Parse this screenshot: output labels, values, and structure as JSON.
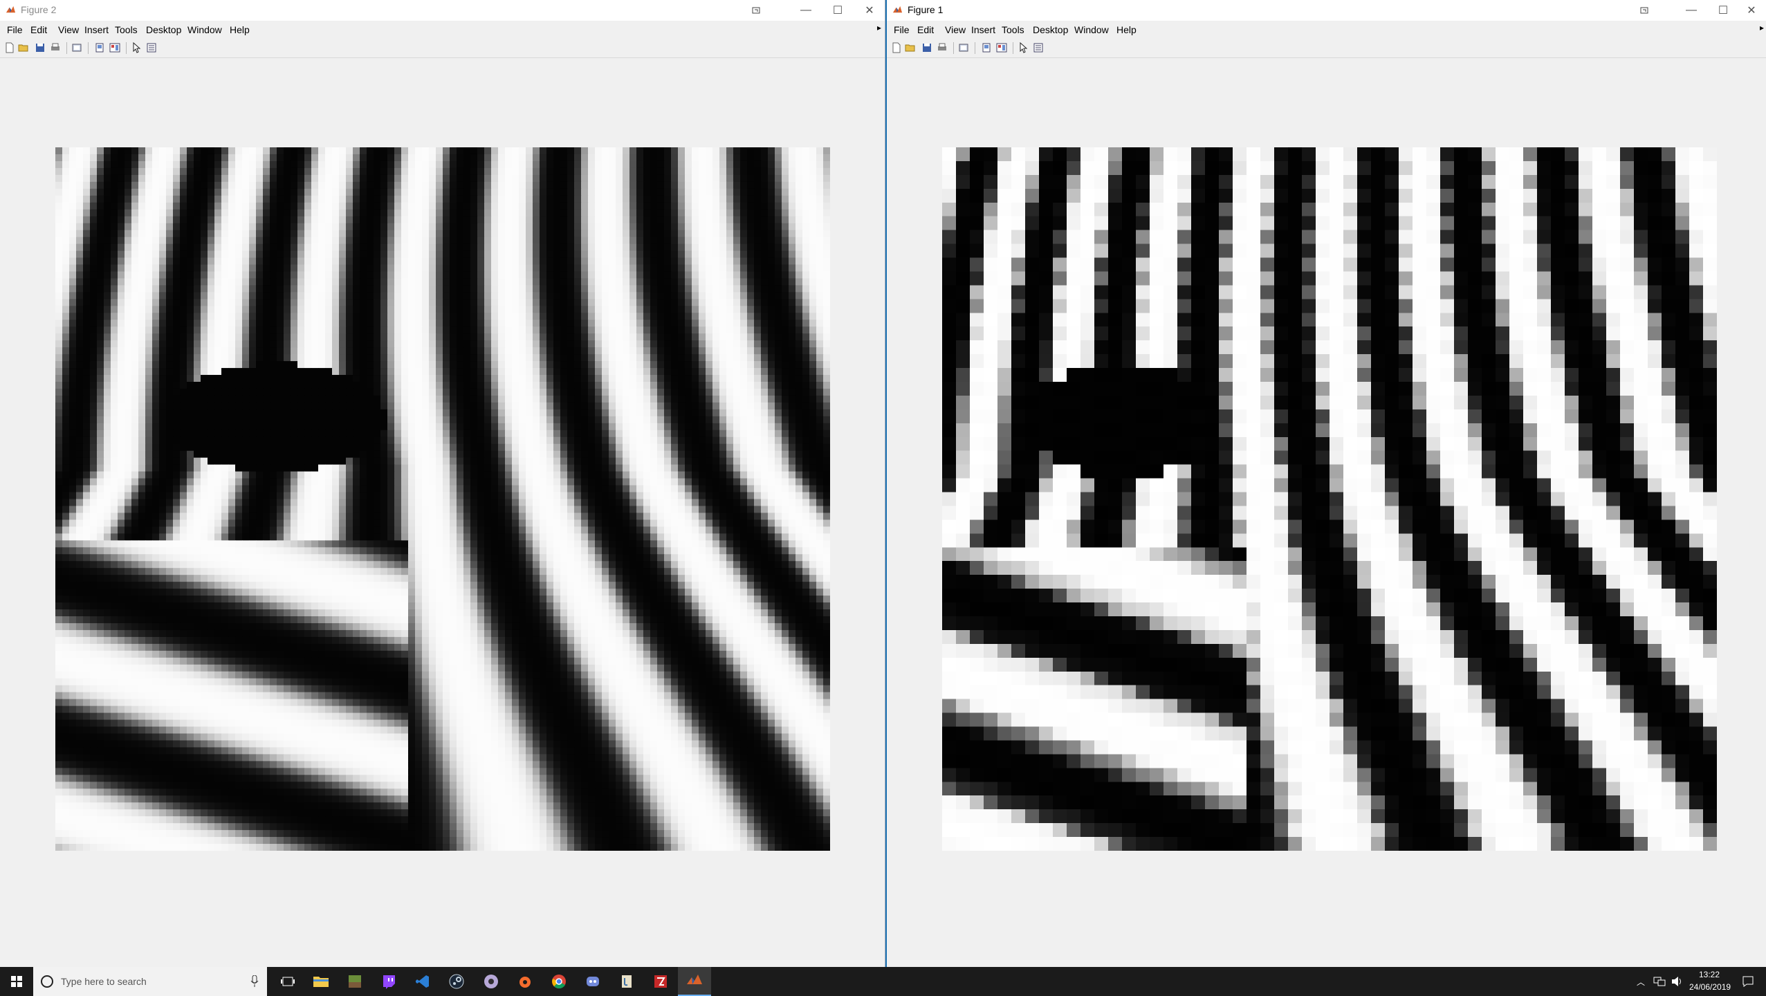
{
  "windows": [
    {
      "id": "win2",
      "title": "Figure 2",
      "menu": [
        "File",
        "Edit",
        "View",
        "Insert",
        "Tools",
        "Desktop",
        "Window",
        "Help"
      ],
      "image": "zebra stripes smooth interpolation",
      "smooth": true
    },
    {
      "id": "win1",
      "title": "Figure 1",
      "menu": [
        "File",
        "Edit",
        "View",
        "Insert",
        "Tools",
        "Desktop",
        "Window",
        "Help"
      ],
      "image": "zebra stripes pixelated",
      "smooth": false
    }
  ],
  "toolbar_icons": [
    "new-figure-icon",
    "open-file-icon",
    "save-icon",
    "print-icon",
    "print-preview-icon",
    "hide-plot-tools-icon",
    "show-plot-tools-icon",
    "edit-plot-icon",
    "open-property-inspector-icon"
  ],
  "taskbar": {
    "search_placeholder": "Type here to search",
    "apps": [
      "file-explorer-icon",
      "minecraft-icon",
      "twitch-icon",
      "vscode-icon",
      "steam-icon",
      "obs-icon",
      "origin-icon",
      "chrome-icon",
      "discord-icon",
      "java-icon",
      "game-icon",
      "matlab-icon"
    ],
    "time": "13:22",
    "date": "24/06/2019"
  },
  "colors": {
    "title_active": "#000000",
    "title_inactive": "#8a8a8a",
    "accent": "#1a6fb0",
    "taskbar": "#1b1b1b"
  }
}
